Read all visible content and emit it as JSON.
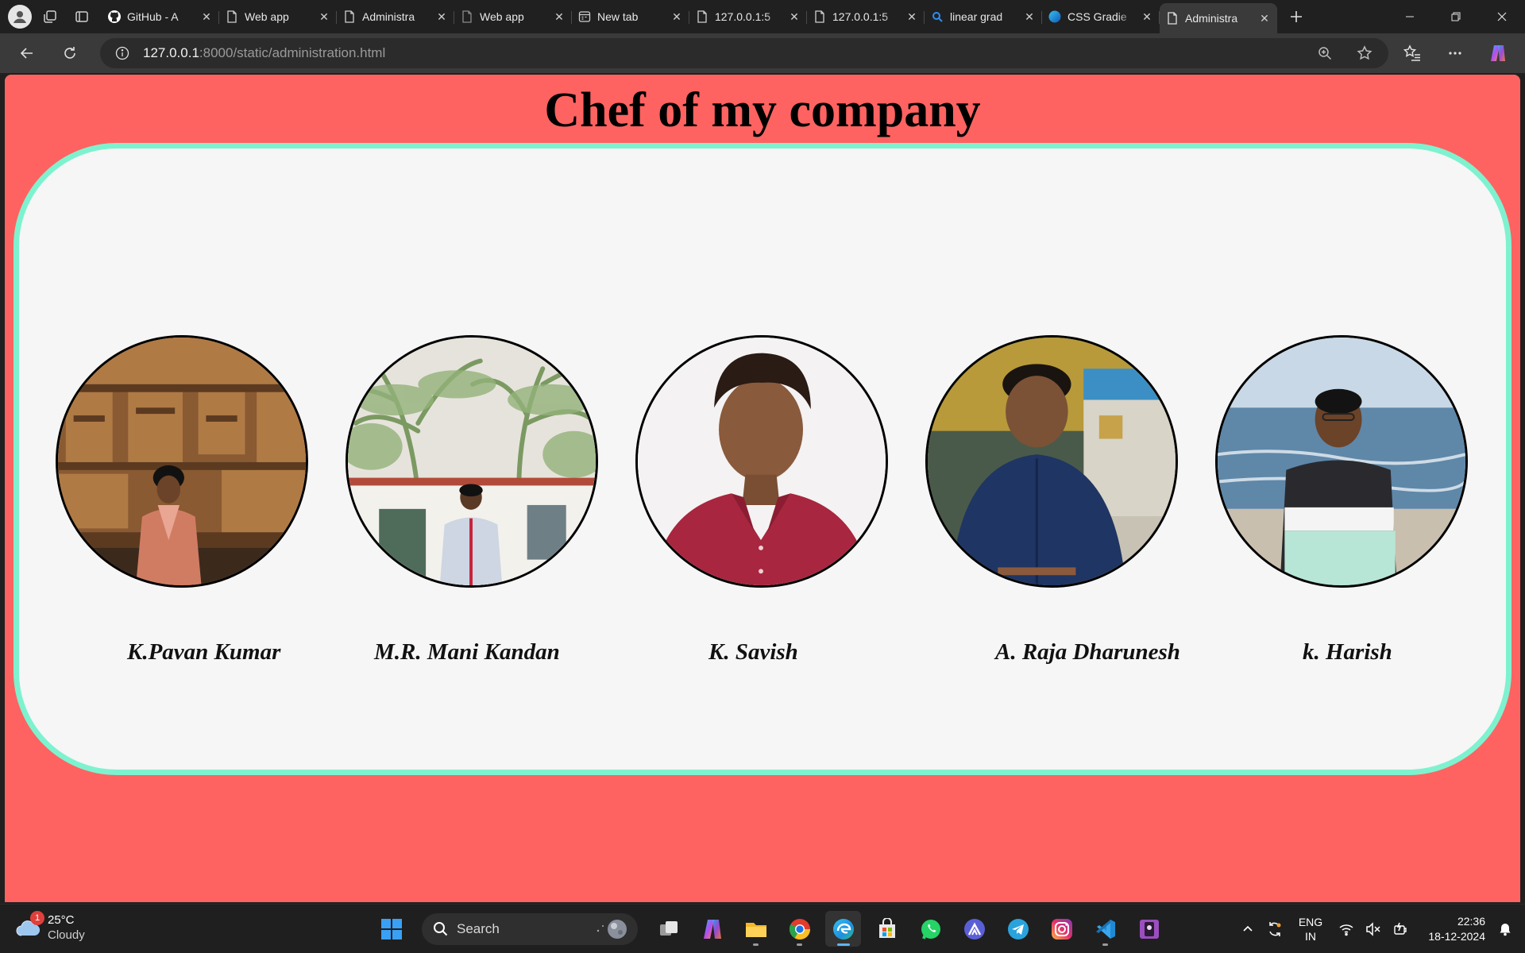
{
  "browser": {
    "tabs": [
      {
        "label": "GitHub - A",
        "icon": "github-icon"
      },
      {
        "label": "Web app",
        "icon": "page-icon"
      },
      {
        "label": "Administra",
        "icon": "page-icon"
      },
      {
        "label": "Web app",
        "icon": "page-icon"
      },
      {
        "label": "New tab",
        "icon": "newtab-icon"
      },
      {
        "label": "127.0.0.1:5",
        "icon": "page-icon"
      },
      {
        "label": "127.0.0.1:5",
        "icon": "page-icon"
      },
      {
        "label": "linear grad",
        "icon": "search-icon"
      },
      {
        "label": "CSS Gradie",
        "icon": "edge-icon"
      },
      {
        "label": "Administra",
        "icon": "page-icon",
        "active": true
      }
    ],
    "address": {
      "host": "127.0.0.1",
      "path": ":8000/static/administration.html"
    }
  },
  "page": {
    "title": "Chef of my company",
    "background_color": "#ff6361",
    "card_border_color": "#7ef2cf",
    "people": [
      {
        "name": "K.Pavan Kumar",
        "photo": "temple-background"
      },
      {
        "name": "M.R. Mani Kandan",
        "photo": "palm-trees-background"
      },
      {
        "name": "K. Savish",
        "photo": "white-background"
      },
      {
        "name": "A. Raja Dharunesh",
        "photo": "street-background"
      },
      {
        "name": "k. Harish",
        "photo": "beach-background"
      }
    ]
  },
  "taskbar": {
    "weather": {
      "temp": "25°C",
      "condition": "Cloudy",
      "badge": "1"
    },
    "search_label": "Search",
    "tray": {
      "lang_line1": "ENG",
      "lang_line2": "IN",
      "time": "22:36",
      "date": "18-12-2024"
    }
  }
}
